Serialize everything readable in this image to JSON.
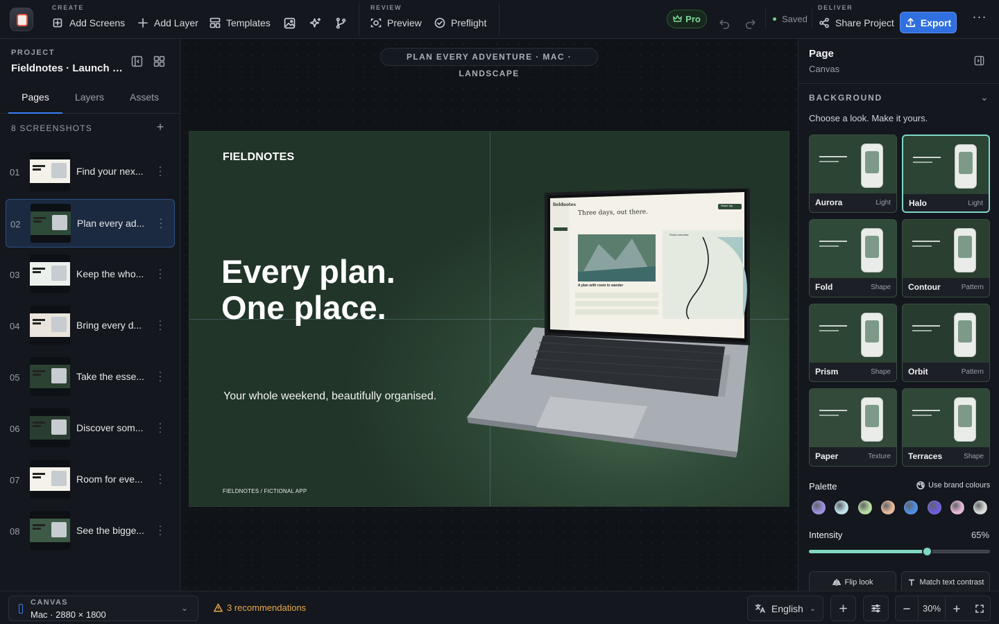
{
  "toolbar": {
    "create_label": "CREATE",
    "add_screens": "Add Screens",
    "add_layer": "Add Layer",
    "templates": "Templates",
    "review_label": "REVIEW",
    "preview": "Preview",
    "preflight": "Preflight",
    "pro_badge": "Pro",
    "saved": "Saved",
    "deliver_label": "DELIVER",
    "share_project": "Share Project",
    "export": "Export"
  },
  "sidebar": {
    "project_label": "PROJECT",
    "project_name": "Fieldnotes · Launch co...",
    "tabs": [
      "Pages",
      "Layers",
      "Assets"
    ],
    "active_tab": "Pages",
    "screenshots_label": "8 SCREENSHOTS",
    "screenshots": [
      {
        "num": "01",
        "title": "Find your nex..."
      },
      {
        "num": "02",
        "title": "Plan every ad...",
        "selected": true
      },
      {
        "num": "03",
        "title": "Keep the who..."
      },
      {
        "num": "04",
        "title": "Bring every d..."
      },
      {
        "num": "05",
        "title": "Take the esse..."
      },
      {
        "num": "06",
        "title": "Discover som..."
      },
      {
        "num": "07",
        "title": "Room for eve..."
      },
      {
        "num": "08",
        "title": "See the bigge..."
      }
    ]
  },
  "canvas": {
    "pill": "PLAN EVERY ADVENTURE · MAC · LANDSCAPE",
    "artboard": {
      "brand": "FIELDNOTES",
      "headline_line1": "Every plan.",
      "headline_line2": "One place.",
      "subline": "Your whole weekend, beautifully organised.",
      "footer": "FIELDNOTES / FICTIONAL APP"
    }
  },
  "inspector": {
    "title": "Page",
    "subtitle": "Canvas",
    "background_label": "BACKGROUND",
    "hint": "Choose a look. Make it yours.",
    "looks": [
      {
        "name": "Aurora",
        "kind": "Light"
      },
      {
        "name": "Halo",
        "kind": "Light",
        "selected": true
      },
      {
        "name": "Fold",
        "kind": "Shape"
      },
      {
        "name": "Contour",
        "kind": "Pattern"
      },
      {
        "name": "Prism",
        "kind": "Shape"
      },
      {
        "name": "Orbit",
        "kind": "Pattern"
      },
      {
        "name": "Paper",
        "kind": "Texture"
      },
      {
        "name": "Terraces",
        "kind": "Shape"
      }
    ],
    "palette_label": "Palette",
    "brand_colours": "Use brand colours",
    "swatches": [
      "#9b8ee0",
      "#bfe3ea",
      "#b8dca0",
      "#e8b89a",
      "#4e8ee6",
      "#6d5be0",
      "#e6b6d6",
      "#d9dcd8"
    ],
    "intensity_label": "Intensity",
    "intensity_value": "65%",
    "intensity": 0.65,
    "flip_look": "Flip look",
    "match_contrast": "Match text contrast"
  },
  "bottombar": {
    "canvas_label": "CANVAS",
    "canvas_value": "Mac · 2880 × 1800",
    "recommendations": "3 recommendations",
    "language": "English",
    "zoom": "30%"
  },
  "laptop_screen": {
    "app_name": "fieldnotes",
    "title": "Three days, out there.",
    "subtitle": "A plan with room to wander",
    "button": "Share trip",
    "route_label": "Route overview"
  },
  "colors": {
    "accent": "#3b82f6",
    "export": "#2f6fe0",
    "pro": "#7fd99a",
    "warning": "#e8a94a",
    "slider": "#7fd8c0"
  }
}
